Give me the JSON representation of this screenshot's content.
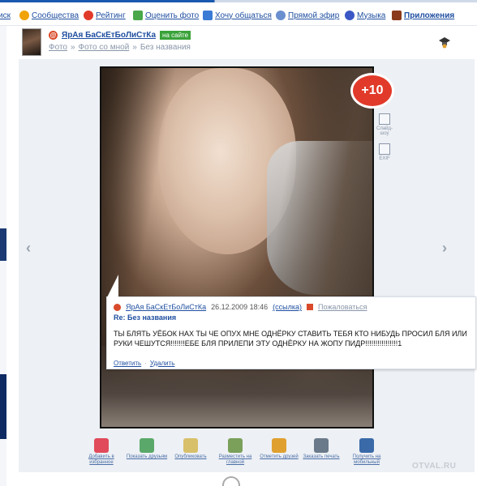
{
  "nav": {
    "items": [
      {
        "label": "иск",
        "icon": "partial-icon",
        "color": "#1f4fa0"
      },
      {
        "label": "Сообщества",
        "icon": "smile-icon",
        "color": "#f0a30a"
      },
      {
        "label": "Рейтинг",
        "icon": "rating-icon",
        "color": "#e13a2a"
      },
      {
        "label": "Оценить фото",
        "icon": "photo-icon",
        "color": "#4aa84a"
      },
      {
        "label": "Хочу общаться",
        "icon": "chat-icon",
        "color": "#3a7bd5"
      },
      {
        "label": "Прямой эфир",
        "icon": "bubble-icon",
        "color": "#6a8fcf"
      },
      {
        "label": "Музыка",
        "icon": "music-icon",
        "color": "#3a57c5"
      },
      {
        "label": "Приложения",
        "icon": "apps-icon",
        "color": "#8a3a1a"
      }
    ]
  },
  "header": {
    "username": "ЯрАя БаСкЕтБоЛиСтКа",
    "online_badge": "на сайте",
    "breadcrumbs": [
      "Фото",
      "Фото со мной",
      "Без названия"
    ]
  },
  "photo": {
    "score_badge": "+10",
    "side_buttons": [
      {
        "label": "Слайд-шоу",
        "icon": "slideshow-icon"
      },
      {
        "label": "EXIF",
        "icon": "exif-icon"
      }
    ]
  },
  "comment": {
    "author": "ЯрАя БаСкЕтБоЛиСтКа",
    "date": "26.12.2009  18:46",
    "link_label": "(ссылка)",
    "report_label": "Пожаловаться",
    "title": "Re: Без названия",
    "text": "ТЫ БЛЯТЬ УЁБОК НАХ ТЫ ЧЕ ОПУХ МНЕ ОДНЁРКУ СТАВИТЬ ТЕБЯ КТО НИБУДЬ ПРОСИЛ БЛЯ ИЛИ РУКИ ЧЕШУТСЯ!!!!!!!ЕБЕ БЛЯ ПРИЛЕПИ ЭТУ ОДНЁРКУ НА ЖОПУ ПИДР!!!!!!!!!!!!!!!!1",
    "reply_label": "Ответить",
    "delete_label": "Удалить"
  },
  "toolbar": [
    {
      "label": "Добавить в избранное",
      "icon": "heart-icon",
      "color": "#e04a5a"
    },
    {
      "label": "Показать друзьям",
      "icon": "friends-icon",
      "color": "#5aa86a"
    },
    {
      "label": "Опубликовать",
      "icon": "publish-icon",
      "color": "#d8c06a"
    },
    {
      "label": "Разместить на главной",
      "icon": "main-page-icon",
      "color": "#7aa05a"
    },
    {
      "label": "Отметить друзей",
      "icon": "tag-friends-icon",
      "color": "#e0a030"
    },
    {
      "label": "Заказать печать",
      "icon": "print-icon",
      "color": "#6a7a8a"
    },
    {
      "label": "Получить на мобильный",
      "icon": "mobile-icon",
      "color": "#3a6aa8"
    }
  ],
  "watermark": "OTVAL.RU"
}
